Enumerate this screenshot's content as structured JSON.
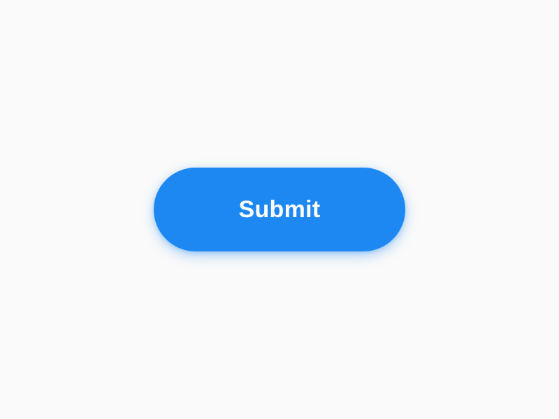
{
  "button": {
    "label": "Submit"
  }
}
